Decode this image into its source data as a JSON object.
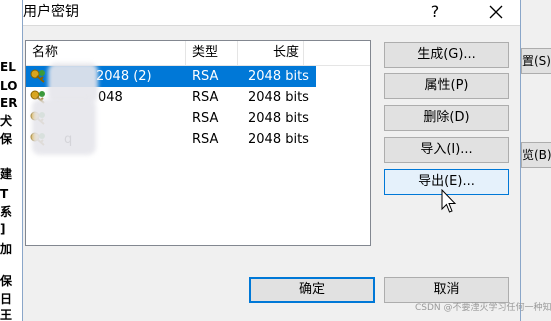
{
  "dialog": {
    "title": "用户密钥",
    "help_label": "?"
  },
  "list": {
    "columns": {
      "name": "名称",
      "type": "类型",
      "length": "长度"
    },
    "rows": [
      {
        "name": "2048 (2)",
        "type": "RSA",
        "length": "2048 bits",
        "selected": true
      },
      {
        "name": "048",
        "type": "RSA",
        "length": "2048 bits",
        "selected": false
      },
      {
        "name": "",
        "type": "RSA",
        "length": "2048 bits",
        "selected": false
      },
      {
        "name": "q",
        "type": "RSA",
        "length": "2048 bits",
        "selected": false
      }
    ]
  },
  "buttons": {
    "generate": "生成(G)...",
    "properties": "属性(P)",
    "delete": "删除(D)",
    "import": "导入(I)...",
    "export": "导出(E)...",
    "ok": "确定",
    "cancel": "取消"
  },
  "background": {
    "left_fragments": [
      "EL",
      "LO",
      "ER",
      "犬",
      "保",
      "建",
      "T",
      "系",
      "]",
      "加",
      "保",
      "日",
      "王"
    ],
    "right_buttons": [
      "置(S)",
      "览(B)"
    ]
  },
  "watermark": "CSDN @不要湮灭学习任何一种知识",
  "colors": {
    "selection": "#0078d7",
    "dialog_bg": "#f0f0f0"
  }
}
